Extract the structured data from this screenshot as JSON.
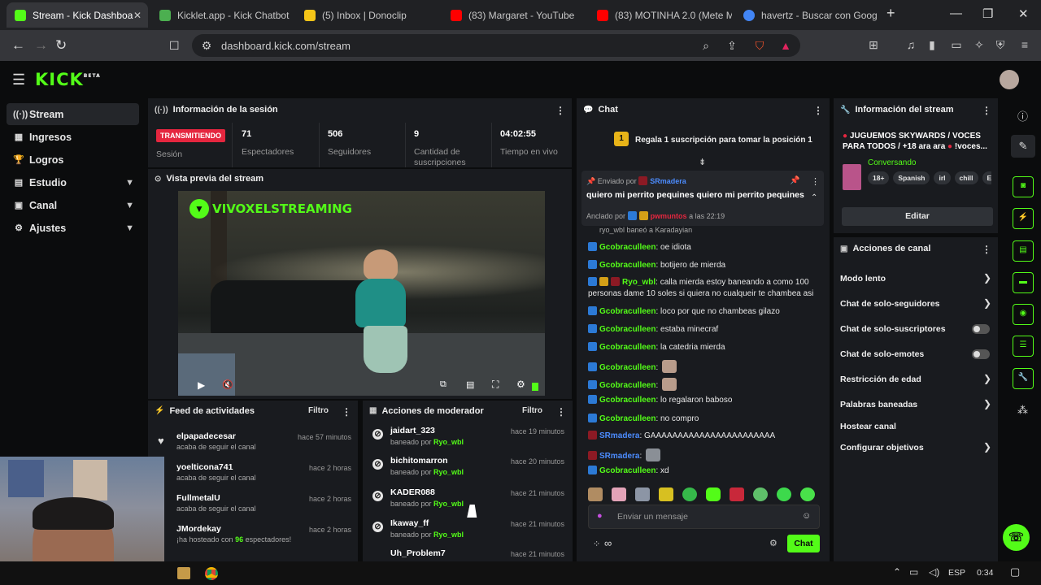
{
  "browser": {
    "tabs": [
      {
        "title": "Stream - Kick Dashboa",
        "active": true,
        "icon_color": "#53fc18"
      },
      {
        "title": "Kicklet.app - Kick Chatbot",
        "icon_color": "#4caf50"
      },
      {
        "title": "(5) Inbox | Donoclip",
        "icon_color": "#f5c518"
      },
      {
        "title": "(83) Margaret - YouTube",
        "icon_color": "#ff0000"
      },
      {
        "title": "(83) MOTINHA 2.0 (Mete M",
        "icon_color": "#ff0000"
      },
      {
        "title": "havertz - Buscar con Goog",
        "icon_color": "#4285f4"
      }
    ],
    "url": "dashboard.kick.com/stream"
  },
  "app": {
    "logo": "KICK",
    "logo_sup": "BETA"
  },
  "sidebar": {
    "items": [
      {
        "label": "Stream",
        "icon": "broadcast-icon"
      },
      {
        "label": "Ingresos",
        "icon": "revenue-icon"
      },
      {
        "label": "Logros",
        "icon": "trophy-icon"
      },
      {
        "label": "Estudio",
        "icon": "studio-icon"
      },
      {
        "label": "Canal",
        "icon": "channel-icon"
      },
      {
        "label": "Ajustes",
        "icon": "gear-icon"
      }
    ]
  },
  "session": {
    "title": "Información de la sesión",
    "status_badge": "TRANSMITIENDO",
    "status_label": "Sesión",
    "stats": [
      {
        "value": "71",
        "label": "Espectadores"
      },
      {
        "value": "506",
        "label": "Seguidores"
      },
      {
        "value": "9",
        "label": "Cantidad de suscripciones"
      },
      {
        "value": "04:02:55",
        "label": "Tiempo en vivo"
      }
    ]
  },
  "preview": {
    "title": "Vista previa del stream",
    "overlay_text": "VIVOXELSTREAMING"
  },
  "feed": {
    "title": "Feed de actividades",
    "filter": "Filtro",
    "items": [
      {
        "name": "elpapadecesar",
        "sub": "acaba de seguir el canal",
        "time": "hace 57 minutos"
      },
      {
        "name": "yoelticona741",
        "sub": "acaba de seguir el canal",
        "time": "hace 2 horas"
      },
      {
        "name": "FullmetalU",
        "sub": "acaba de seguir el canal",
        "time": "hace 2 horas"
      },
      {
        "name": "JMordekay",
        "sub_prefix": "¡ha hosteado con ",
        "sub_count": "96",
        "sub_suffix": " espectadores!",
        "time": "hace 2 horas"
      }
    ]
  },
  "moderation": {
    "title": "Acciones de moderador",
    "filter": "Filtro",
    "banned_by_prefix": "baneado por ",
    "items": [
      {
        "name": "jaidart_323",
        "by": "Ryo_wbl",
        "time": "hace 19 minutos"
      },
      {
        "name": "bichitomarron",
        "by": "Ryo_wbl",
        "time": "hace 20 minutos"
      },
      {
        "name": "KADER088",
        "by": "Ryo_wbl",
        "time": "hace 21 minutos"
      },
      {
        "name": "Ikaway_ff",
        "by": "Ryo_wbl",
        "time": "hace 21 minutos"
      },
      {
        "name": "Uh_Problem7",
        "by": "",
        "time": "hace 21 minutos"
      }
    ]
  },
  "chat": {
    "title": "Chat",
    "promo_number": "1",
    "promo_text": "Regala 1 suscripción para tomar la posición 1",
    "pinned": {
      "sent_by_label": "Enviado por",
      "sent_by": "SRmadera",
      "text": "quiero mi perrito pequines quiero mi perrito pequines",
      "pinned_by_label": "Anclado por",
      "pinned_by": "pwmuntos",
      "pinned_time": "a las 22:19",
      "behind_text": "ryo_wbl baneó a Karadayian"
    },
    "messages": [
      {
        "user": "Gcobraculleen",
        "text": "oe idiota"
      },
      {
        "user": "Gcobraculleen",
        "text": "botijero de mierda"
      },
      {
        "user": "Ryo_wbl",
        "text": "calla mierda estoy baneando a como 100 personas dame 10 soles si quiera no cualqueir te chambea asi"
      },
      {
        "user": "Gcobraculleen",
        "text": "loco por que no chambeas gilazo"
      },
      {
        "user": "Gcobraculleen",
        "text": "estaba minecraf"
      },
      {
        "user": "Gcobraculleen",
        "text": "la catedria mierda"
      },
      {
        "user": "Gcobraculleen",
        "text": ""
      },
      {
        "user": "Gcobraculleen",
        "text": ""
      },
      {
        "user": "Gcobraculleen",
        "text": "lo regalaron baboso"
      },
      {
        "user": "Gcobraculleen",
        "text": "no compro"
      },
      {
        "user": "SRmadera",
        "text": "GAAAAAAAAAAAAAAAAAAAAAAA"
      },
      {
        "user": "SRmadera",
        "text": ""
      },
      {
        "user": "Gcobraculleen",
        "text": "xd"
      }
    ],
    "input_placeholder": "Enviar un mensaje",
    "send_label": "Chat",
    "points": "∞"
  },
  "stream_info": {
    "title": "Información del stream",
    "stream_title": "JUGUEMOS SKYWARDS / VOCES PARA TODOS / +18 ara ara",
    "stream_title_suffix": "!voces...",
    "category": "Conversando",
    "tags": [
      "18+",
      "Spanish",
      "irl",
      "chill",
      "Esp"
    ],
    "edit_label": "Editar"
  },
  "channel_actions": {
    "title": "Acciones de canal",
    "items": [
      {
        "label": "Modo lento",
        "control": "chevron"
      },
      {
        "label": "Chat de solo-seguidores",
        "control": "chevron"
      },
      {
        "label": "Chat de solo-suscriptores",
        "control": "toggle"
      },
      {
        "label": "Chat de solo-emotes",
        "control": "toggle"
      },
      {
        "label": "Restricción de edad",
        "control": "chevron"
      },
      {
        "label": "Palabras baneadas",
        "control": "chevron"
      },
      {
        "label": "Hostear canal",
        "control": "none"
      },
      {
        "label": "Configurar objetivos",
        "control": "chevron"
      }
    ]
  },
  "taskbar": {
    "lang": "ESP",
    "time": "0:34"
  },
  "colors": {
    "accent": "#53fc18",
    "live": "#e5263f",
    "panel": "#191b1f",
    "bg": "#0b0c0d"
  }
}
